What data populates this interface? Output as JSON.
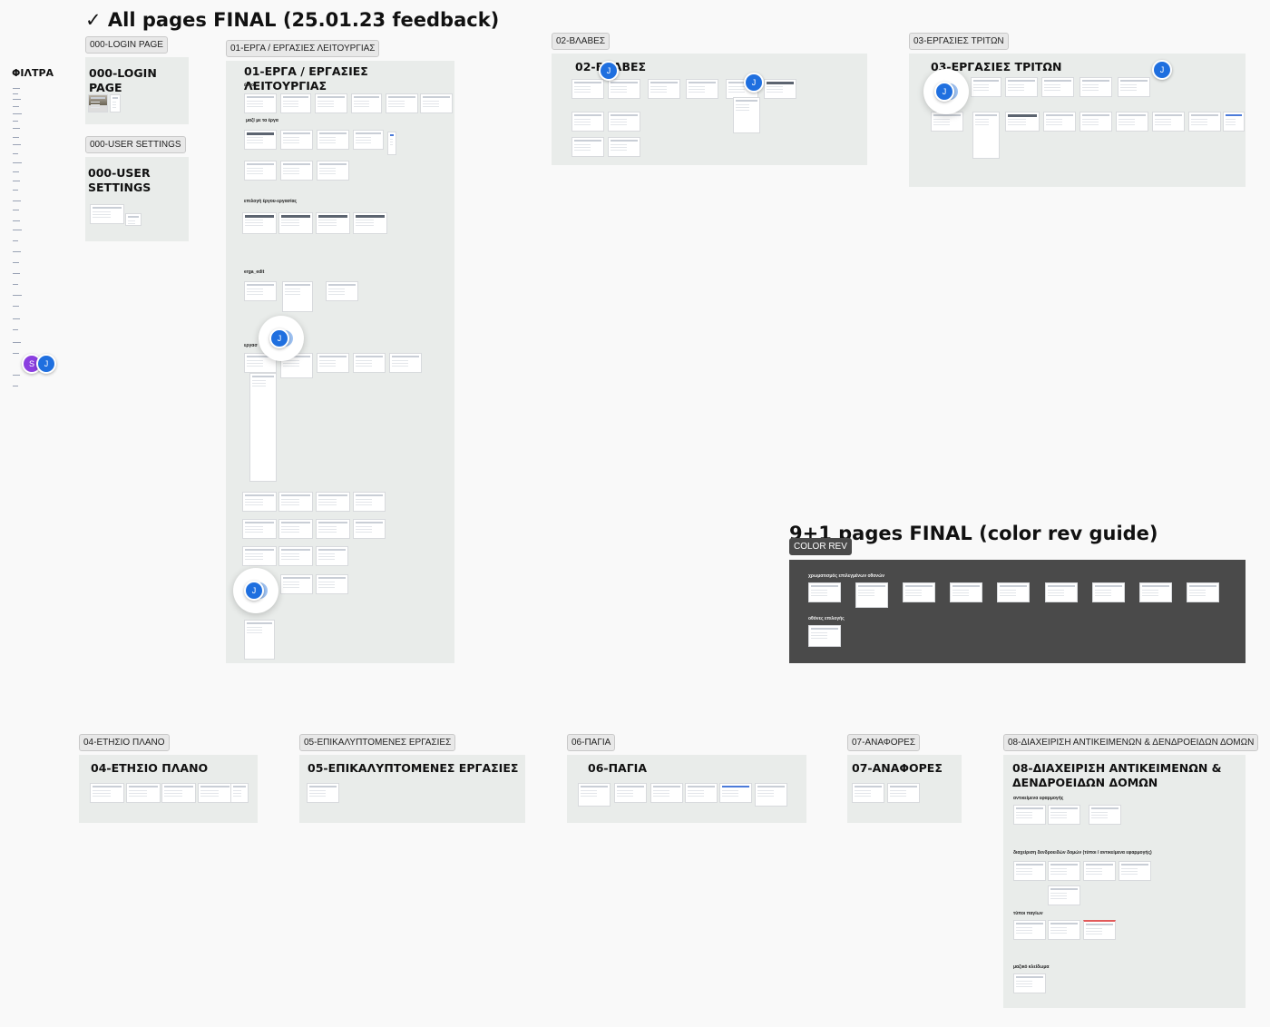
{
  "page": {
    "title": "All pages FINAL (25.01.23 feedback)",
    "title_check": "✓",
    "color_rev_title": "9+1 pages FINAL (color rev guide)",
    "filters_label": "ΦΙΛΤΡΑ"
  },
  "sections": {
    "login": {
      "tag": "000-LOGIN PAGE",
      "title": "000-LOGIN PAGE"
    },
    "user_settings": {
      "tag": "000-USER SETTINGS",
      "title": "000-USER SETTINGS"
    },
    "erga": {
      "tag": "01-ΕΡΓΑ / ΕΡΓΑΣΙΕΣ ΛΕΙΤΟΥΡΓΙΑΣ",
      "title": "01-ΕΡΓΑ / ΕΡΓΑΣΙΕΣ ΛΕΙΤΟΥΡΓΙΑΣ",
      "groups": [
        "έργα",
        "μαζί με τα έργα",
        "επιλογή έργου-εργασίας",
        "erga_edit",
        "εργασ"
      ]
    },
    "vlaves": {
      "tag": "02-ΒΛΑΒΕΣ",
      "title": "02-ΒΛΑΒΕΣ"
    },
    "tritoi": {
      "tag": "03-ΕΡΓΑΣΙΕΣ ΤΡΙΤΩΝ",
      "title": "03-ΕΡΓΑΣΙΕΣ ΤΡΙΤΩΝ"
    },
    "color_rev": {
      "tag": "COLOR REV",
      "groups": [
        "χρωματισμός επιλεγμένων οθονών",
        "οθόνες επιλογής"
      ]
    },
    "plano": {
      "tag": "04-ΕΤΗΣΙΟ ΠΛΑΝΟ",
      "title": "04-ΕΤΗΣΙΟ ΠΛΑΝΟ"
    },
    "epikalyptomenes": {
      "tag": "05-ΕΠΙΚΑΛΥΠΤΟΜΕΝΕΣ ΕΡΓΑΣΙΕΣ",
      "title": "05-ΕΠΙΚΑΛΥΠΤΟΜΕΝΕΣ ΕΡΓΑΣΙΕΣ"
    },
    "pagia": {
      "tag": "06-ΠΑΓΙΑ",
      "title": "06-ΠΑΓΙΑ"
    },
    "anafores": {
      "tag": "07-ΑΝΑΦΟΡΕΣ",
      "title": "07-ΑΝΑΦΟΡΕΣ"
    },
    "diaxeirisi": {
      "tag": "08-ΔΙΑΧΕΙΡΙΣΗ ΑΝΤΙΚΕΙΜΕΝΩΝ & ΔΕΝΔΡΟΕΙΔΩΝ ΔΟΜΩΝ",
      "title": "08-ΔΙΑΧΕΙΡΙΣΗ ΑΝΤΙΚΕΙΜΕΝΩΝ & ΔΕΝΔΡΟΕΙΔΩΝ ΔΟΜΩΝ",
      "groups": [
        "αντικείμενα εφαρμογής",
        "διαχείριση δενδροειδών δομών (τύποι / αντικείμενα εφαρμογής)",
        "τύποι παγίων",
        "μαζικό κλείδωμα"
      ]
    }
  },
  "collaborators": {
    "j": "J",
    "s": "S"
  },
  "colors": {
    "accent": "#1f6fdf",
    "purple": "#8b3fe0",
    "section_bg": "#e9ecea",
    "dark_section": "#4a4a4a"
  }
}
